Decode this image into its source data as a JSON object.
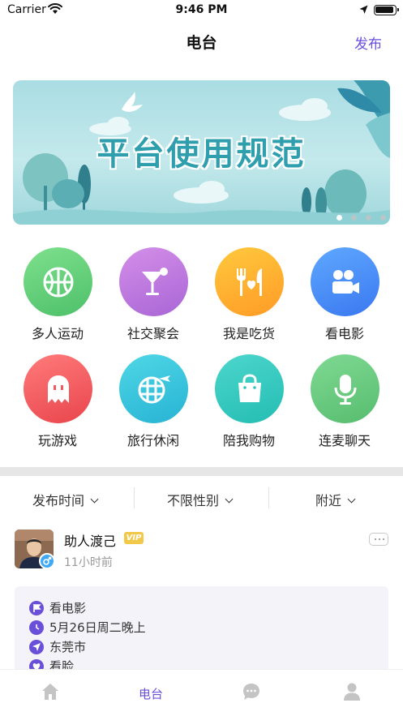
{
  "status_bar": {
    "carrier": "Carrier",
    "time": "9:46 PM"
  },
  "nav": {
    "title": "电台",
    "action": "发布"
  },
  "banner": {
    "text": "平台使用规范",
    "page_count": 4,
    "active_page": 1
  },
  "categories": [
    {
      "label": "多人运动",
      "icon": "basketball-icon",
      "gradient": [
        "#7ee08c",
        "#4ec06a"
      ]
    },
    {
      "label": "社交聚会",
      "icon": "cocktail-icon",
      "gradient": [
        "#d48ee8",
        "#a966d6"
      ]
    },
    {
      "label": "我是吃货",
      "icon": "dining-icon",
      "gradient": [
        "#ffc93d",
        "#ff9b26"
      ]
    },
    {
      "label": "看电影",
      "icon": "movie-camera-icon",
      "gradient": [
        "#5fa8ff",
        "#3a78f0"
      ]
    },
    {
      "label": "玩游戏",
      "icon": "ghost-icon",
      "gradient": [
        "#ff7b7b",
        "#e8454c"
      ]
    },
    {
      "label": "旅行休闲",
      "icon": "globe-plane-icon",
      "gradient": [
        "#4fd7e6",
        "#27b3d4"
      ]
    },
    {
      "label": "陪我购物",
      "icon": "shopping-bag-icon",
      "gradient": [
        "#4cd6cc",
        "#24bdb3"
      ]
    },
    {
      "label": "连麦聊天",
      "icon": "microphone-icon",
      "gradient": [
        "#7fd992",
        "#57bd6f"
      ]
    }
  ],
  "filters": [
    {
      "label": "发布时间"
    },
    {
      "label": "不限性别"
    },
    {
      "label": "附近"
    }
  ],
  "post": {
    "username": "助人渡己",
    "badge": "VIP",
    "time_ago": "11小时前",
    "details": [
      {
        "icon": "flag-icon",
        "text": "看电影"
      },
      {
        "icon": "clock-icon",
        "text": "5月26日周二晚上"
      },
      {
        "icon": "location-icon",
        "text": "东莞市"
      },
      {
        "icon": "heart-icon",
        "text": "看脸"
      }
    ]
  },
  "tabbar": {
    "tabs": [
      {
        "name": "home",
        "label": "",
        "icon": "home-icon"
      },
      {
        "name": "radio",
        "label": "电台",
        "icon": ""
      },
      {
        "name": "messages",
        "label": "",
        "icon": "chat-icon"
      },
      {
        "name": "profile",
        "label": "",
        "icon": "person-icon"
      }
    ],
    "active": "radio"
  },
  "colors": {
    "accent": "#6a4fd8",
    "vip": "#f2c84b",
    "divider": "#e6e6e6",
    "card": "#f3f3f9"
  }
}
